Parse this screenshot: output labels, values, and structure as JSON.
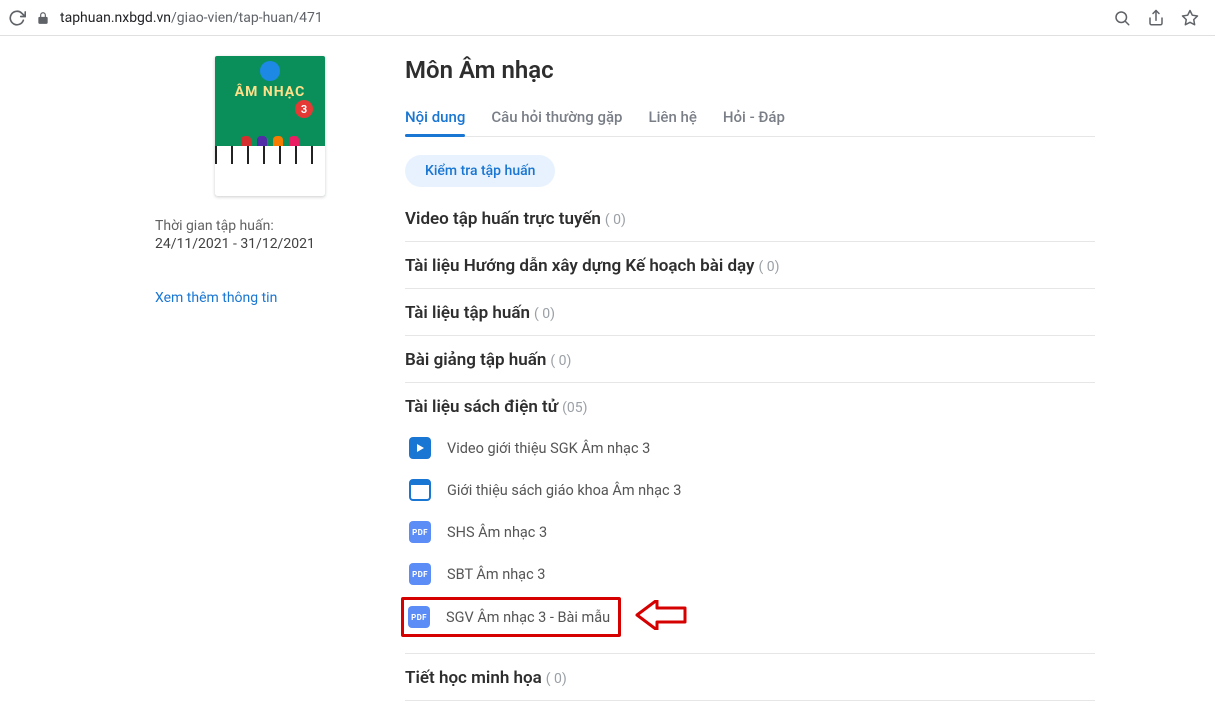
{
  "browser": {
    "url_host": "taphuan.nxbgd.vn",
    "url_path": "/giao-vien/tap-huan/471"
  },
  "sidebar": {
    "book_title": "ÂM NHẠC",
    "grade": "3",
    "meta_label": "Thời gian tập huấn:",
    "meta_dates": "24/11/2021 - 31/12/2021",
    "more_link": "Xem thêm thông tin"
  },
  "main": {
    "title": "Môn Âm nhạc",
    "tabs": [
      {
        "label": "Nội dung",
        "active": true
      },
      {
        "label": "Câu hỏi thường gặp",
        "active": false
      },
      {
        "label": "Liên hệ",
        "active": false
      },
      {
        "label": "Hỏi - Đáp",
        "active": false
      }
    ],
    "exam_button": "Kiểm tra tập huấn",
    "sections": [
      {
        "title": "Video tập huấn trực tuyến",
        "count": "( 0)"
      },
      {
        "title": "Tài liệu Hướng dẫn xây dựng Kế hoạch bài dạy",
        "count": "( 0)"
      },
      {
        "title": "Tài liệu tập huấn",
        "count": "( 0)"
      },
      {
        "title": "Bài giảng tập huấn",
        "count": "( 0)"
      },
      {
        "title": "Tài liệu sách điện tử",
        "count": "(05)",
        "items": [
          {
            "icon": "video",
            "label": "Video giới thiệu SGK Âm nhạc 3"
          },
          {
            "icon": "slides",
            "label": "Giới thiệu sách giáo khoa Âm nhạc 3"
          },
          {
            "icon": "pdf",
            "label": "SHS Âm nhạc 3"
          },
          {
            "icon": "pdf",
            "label": "SBT Âm nhạc 3"
          },
          {
            "icon": "pdf",
            "label": "SGV Âm nhạc 3 - Bài mẫu",
            "highlight": true
          }
        ]
      },
      {
        "title": "Tiết học minh họa",
        "count": "( 0)"
      }
    ],
    "pdf_badge": "PDF"
  }
}
